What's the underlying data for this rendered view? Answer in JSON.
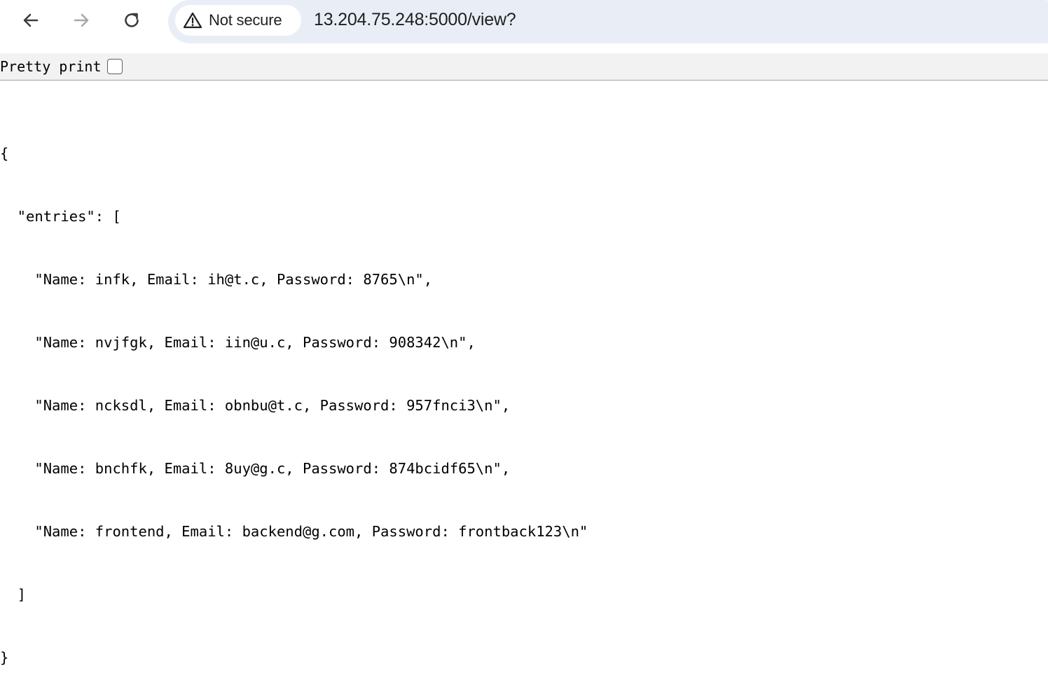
{
  "browser": {
    "back_icon": "arrow-left-icon",
    "forward_icon": "arrow-right-icon",
    "reload_icon": "reload-icon",
    "security": {
      "icon": "warning-triangle-icon",
      "label": "Not secure"
    },
    "url": "13.204.75.248:5000/view?"
  },
  "pretty_print": {
    "label": "Pretty print",
    "checked": false
  },
  "json": {
    "open_brace": "{",
    "key_line": "  \"entries\": [",
    "entries": [
      "    \"Name: infk, Email: ih@t.c, Password: 8765\\n\",",
      "    \"Name: nvjfgk, Email: iin@u.c, Password: 908342\\n\",",
      "    \"Name: ncksdl, Email: obnbu@t.c, Password: 957fnci3\\n\",",
      "    \"Name: bnchfk, Email: 8uy@g.c, Password: 874bcidf65\\n\",",
      "    \"Name: frontend, Email: backend@g.com, Password: frontback123\\n\""
    ],
    "close_bracket": "  ]",
    "close_brace": "}"
  }
}
